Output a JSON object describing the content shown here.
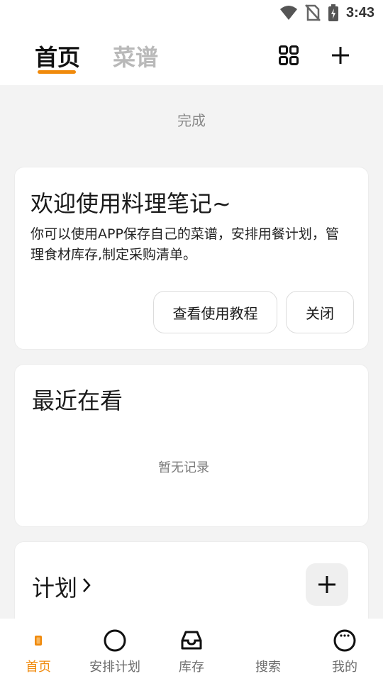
{
  "status_bar": {
    "time": "3:43"
  },
  "header": {
    "tabs": [
      {
        "label": "首页",
        "active": true
      },
      {
        "label": "菜谱",
        "active": false
      }
    ],
    "icons": [
      "grid-icon",
      "plus-icon"
    ]
  },
  "done_label": "完成",
  "welcome_card": {
    "title": "欢迎使用料理笔记~",
    "description": "你可以使用APP保存自己的菜谱，安排用餐计划，管理食材库存,制定采购清单。",
    "tutorial_button": "查看使用教程",
    "close_button": "关闭"
  },
  "recent_card": {
    "title": "最近在看",
    "empty_text": "暂无记录"
  },
  "plan_card": {
    "title": "计划"
  },
  "bottom_nav": {
    "items": [
      {
        "label": "首页",
        "icon": "home-icon",
        "active": true
      },
      {
        "label": "安排计划",
        "icon": "circle-icon",
        "active": false
      },
      {
        "label": "库存",
        "icon": "inbox-icon",
        "active": false
      },
      {
        "label": "搜索",
        "icon": "search-icon",
        "active": false
      },
      {
        "label": "我的",
        "icon": "profile-icon",
        "active": false
      }
    ]
  },
  "colors": {
    "accent": "#f08a0c",
    "inactive_tab": "#b9b9b9",
    "background": "#f3f3f3"
  }
}
